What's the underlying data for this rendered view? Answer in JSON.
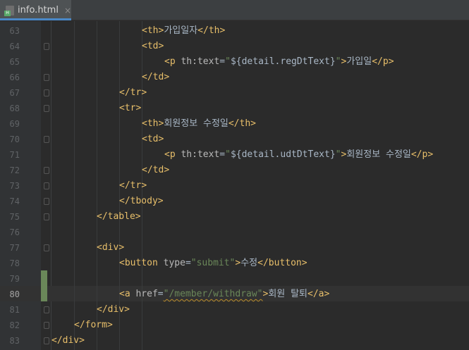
{
  "tab": {
    "title": "info.html",
    "close": "×"
  },
  "lines": [
    {
      "num": "63",
      "indent": 4,
      "parts": [
        [
          "tag",
          "<"
        ],
        [
          "tname",
          "th"
        ],
        [
          "tag",
          ">"
        ],
        [
          "txt",
          "가입일자"
        ],
        [
          "tag",
          "</"
        ],
        [
          "tname",
          "th"
        ],
        [
          "tag",
          ">"
        ]
      ]
    },
    {
      "num": "64",
      "indent": 4,
      "parts": [
        [
          "tag",
          "<"
        ],
        [
          "tname",
          "td"
        ],
        [
          "tag",
          ">"
        ]
      ]
    },
    {
      "num": "65",
      "indent": 5,
      "parts": [
        [
          "tag",
          "<"
        ],
        [
          "tname",
          "p"
        ],
        [
          "txt",
          " "
        ],
        [
          "attr",
          "th:text"
        ],
        [
          "txt",
          "="
        ],
        [
          "str",
          "\""
        ],
        [
          "txt",
          "${detail.regDtText}"
        ],
        [
          "str",
          "\""
        ],
        [
          "tag",
          ">"
        ],
        [
          "txt",
          "가입일"
        ],
        [
          "tag",
          "</"
        ],
        [
          "tname",
          "p"
        ],
        [
          "tag",
          ">"
        ]
      ]
    },
    {
      "num": "66",
      "indent": 4,
      "parts": [
        [
          "tag",
          "</"
        ],
        [
          "tname",
          "td"
        ],
        [
          "tag",
          ">"
        ]
      ]
    },
    {
      "num": "67",
      "indent": 3,
      "parts": [
        [
          "tag",
          "</"
        ],
        [
          "tname",
          "tr"
        ],
        [
          "tag",
          ">"
        ]
      ]
    },
    {
      "num": "68",
      "indent": 3,
      "parts": [
        [
          "tag",
          "<"
        ],
        [
          "tname",
          "tr"
        ],
        [
          "tag",
          ">"
        ]
      ]
    },
    {
      "num": "69",
      "indent": 4,
      "parts": [
        [
          "tag",
          "<"
        ],
        [
          "tname",
          "th"
        ],
        [
          "tag",
          ">"
        ],
        [
          "txt",
          "회원정보 수정일"
        ],
        [
          "tag",
          "</"
        ],
        [
          "tname",
          "th"
        ],
        [
          "tag",
          ">"
        ]
      ]
    },
    {
      "num": "70",
      "indent": 4,
      "parts": [
        [
          "tag",
          "<"
        ],
        [
          "tname",
          "td"
        ],
        [
          "tag",
          ">"
        ]
      ]
    },
    {
      "num": "71",
      "indent": 5,
      "parts": [
        [
          "tag",
          "<"
        ],
        [
          "tname",
          "p"
        ],
        [
          "txt",
          " "
        ],
        [
          "attr",
          "th:text"
        ],
        [
          "txt",
          "="
        ],
        [
          "str",
          "\""
        ],
        [
          "txt",
          "${detail.udtDtText}"
        ],
        [
          "str",
          "\""
        ],
        [
          "tag",
          ">"
        ],
        [
          "txt",
          "회원정보 수정일"
        ],
        [
          "tag",
          "</"
        ],
        [
          "tname",
          "p"
        ],
        [
          "tag",
          ">"
        ]
      ]
    },
    {
      "num": "72",
      "indent": 4,
      "parts": [
        [
          "tag",
          "</"
        ],
        [
          "tname",
          "td"
        ],
        [
          "tag",
          ">"
        ]
      ]
    },
    {
      "num": "73",
      "indent": 3,
      "parts": [
        [
          "tag",
          "</"
        ],
        [
          "tname",
          "tr"
        ],
        [
          "tag",
          ">"
        ]
      ]
    },
    {
      "num": "74",
      "indent": 3,
      "parts": [
        [
          "tag",
          "</"
        ],
        [
          "tname",
          "tbody"
        ],
        [
          "tag",
          ">"
        ]
      ]
    },
    {
      "num": "75",
      "indent": 2,
      "parts": [
        [
          "tag",
          "</"
        ],
        [
          "tname",
          "table"
        ],
        [
          "tag",
          ">"
        ]
      ]
    },
    {
      "num": "76",
      "indent": 0,
      "parts": []
    },
    {
      "num": "77",
      "indent": 2,
      "parts": [
        [
          "tag",
          "<"
        ],
        [
          "tname",
          "div"
        ],
        [
          "tag",
          ">"
        ]
      ]
    },
    {
      "num": "78",
      "indent": 3,
      "parts": [
        [
          "tag",
          "<"
        ],
        [
          "tname",
          "button"
        ],
        [
          "txt",
          " "
        ],
        [
          "attr",
          "type"
        ],
        [
          "txt",
          "="
        ],
        [
          "str",
          "\"submit\""
        ],
        [
          "tag",
          ">"
        ],
        [
          "txt",
          "수정"
        ],
        [
          "tag",
          "</"
        ],
        [
          "tname",
          "button"
        ],
        [
          "tag",
          ">"
        ]
      ]
    },
    {
      "num": "79",
      "indent": 0,
      "parts": []
    },
    {
      "num": "80",
      "indent": 3,
      "parts": [
        [
          "tag",
          "<"
        ],
        [
          "tname",
          "a"
        ],
        [
          "txt",
          " "
        ],
        [
          "attr",
          "href"
        ],
        [
          "txt",
          "="
        ],
        [
          "str",
          "\"/member/withdraw\""
        ],
        [
          "tag",
          ">"
        ],
        [
          "txt",
          "회원 탈퇴"
        ],
        [
          "tag",
          "</"
        ],
        [
          "tname",
          "a"
        ],
        [
          "tag",
          ">"
        ]
      ]
    },
    {
      "num": "81",
      "indent": 2,
      "parts": [
        [
          "tag",
          "</"
        ],
        [
          "tname",
          "div"
        ],
        [
          "tag",
          ">"
        ]
      ]
    },
    {
      "num": "82",
      "indent": 1,
      "parts": [
        [
          "tag",
          "</"
        ],
        [
          "tname",
          "form"
        ],
        [
          "tag",
          ">"
        ]
      ]
    },
    {
      "num": "83",
      "indent": 0,
      "parts": [
        [
          "tag",
          "</"
        ],
        [
          "tname",
          "div"
        ],
        [
          "tag",
          ">"
        ]
      ]
    }
  ],
  "colors": {
    "background": "#2b2b2b",
    "tag": "#e8bf6a",
    "attribute": "#bababa",
    "string": "#6a8759",
    "text": "#a9b7c6",
    "line_number": "#606366",
    "accent": "#4a88c7"
  },
  "current_line": "80"
}
